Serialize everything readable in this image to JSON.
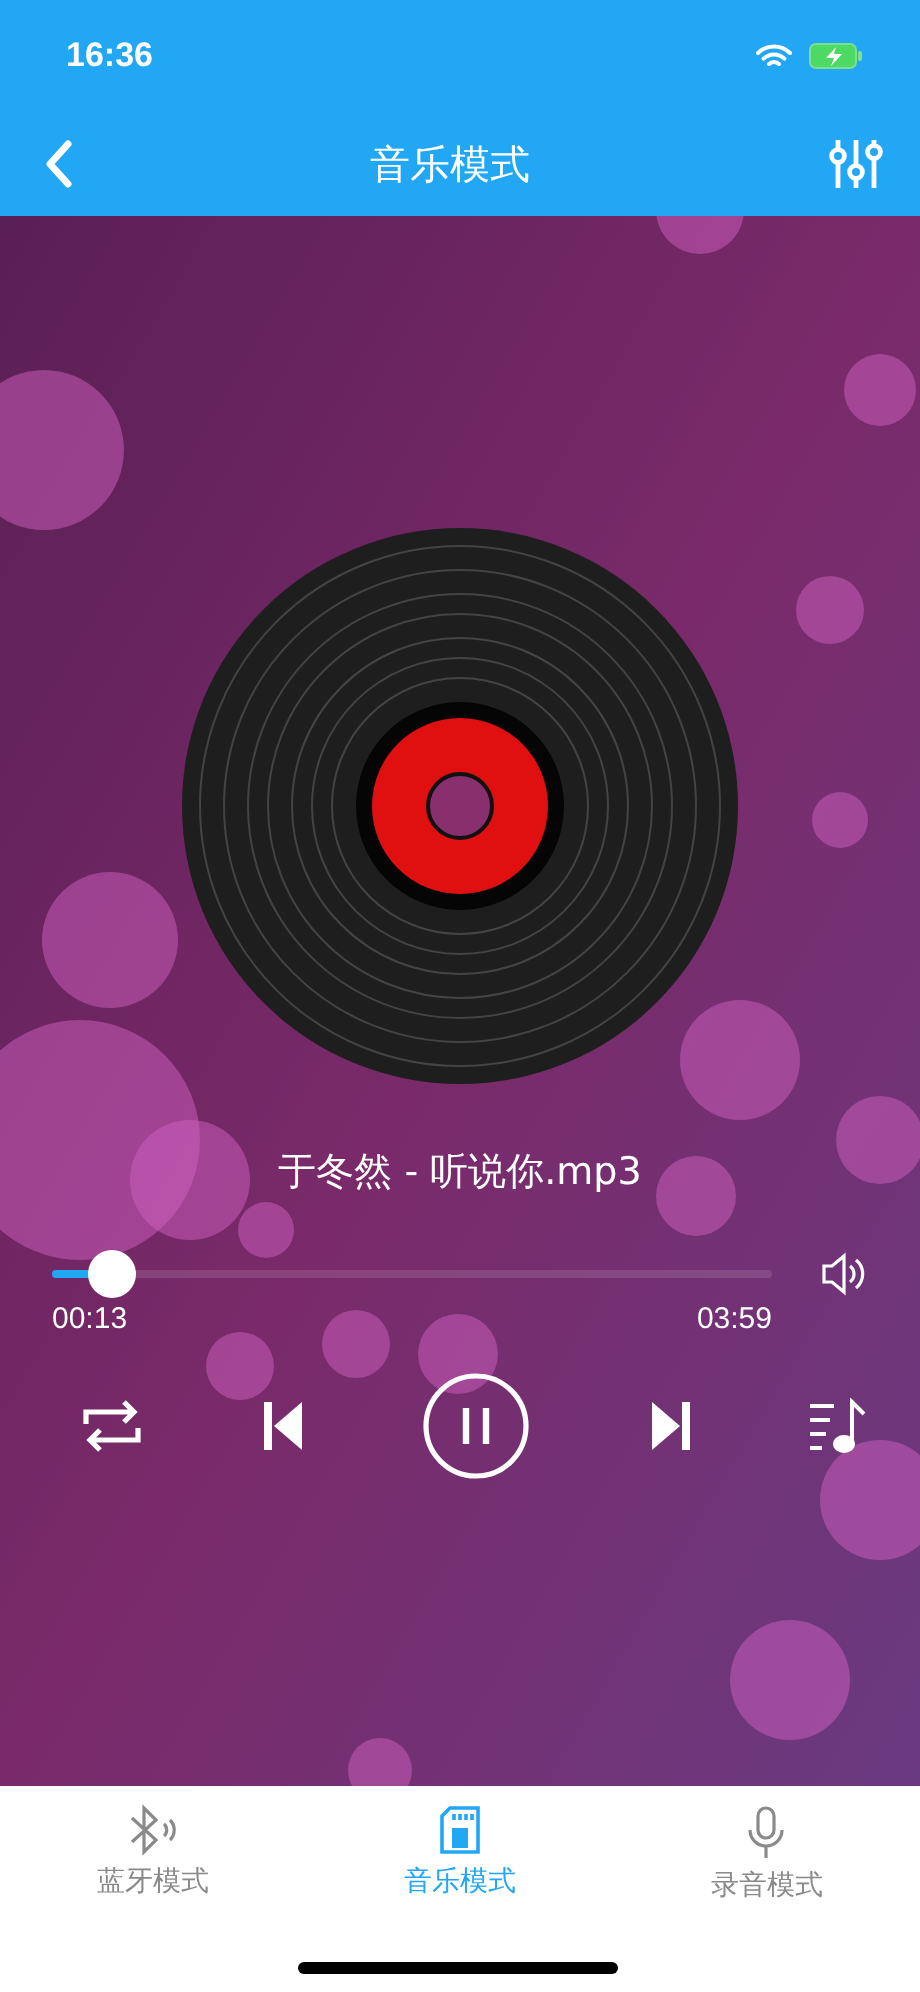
{
  "status_bar": {
    "time": "16:36"
  },
  "nav": {
    "title": "音乐模式"
  },
  "player": {
    "track_title": "于冬然 - 听说你.mp3",
    "progress": {
      "level": 0.06
    },
    "elapsed": "00:13",
    "duration": "03:59",
    "playing": true
  },
  "tabs": [
    {
      "label": "蓝牙模式",
      "kind": "bluetooth",
      "selected": false
    },
    {
      "label": "音乐模式",
      "kind": "sdcard",
      "selected": true
    },
    {
      "label": "录音模式",
      "kind": "mic",
      "selected": false
    }
  ]
}
